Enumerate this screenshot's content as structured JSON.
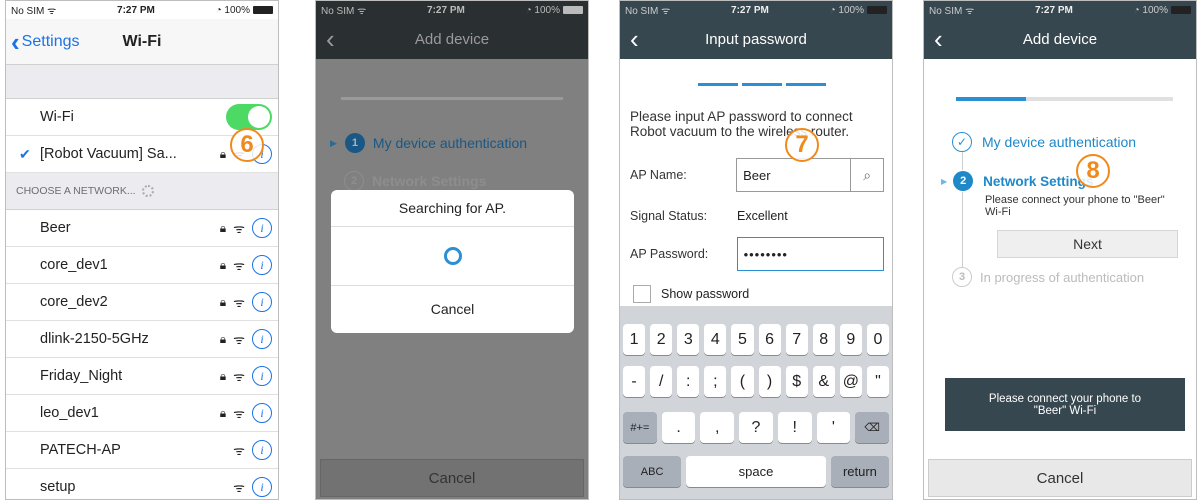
{
  "screen1": {
    "status": {
      "carrier": "No SIM",
      "time": "7:27 PM",
      "battery": "100%"
    },
    "back_label": "Settings",
    "title": "Wi-Fi",
    "wifi_label": "Wi-Fi",
    "connected_network": "[Robot Vacuum] Sa...",
    "section_header": "CHOOSE A NETWORK...",
    "networks": [
      "Beer",
      "core_dev1",
      "core_dev2",
      "dlink-2150-5GHz",
      "Friday_Night",
      "leo_dev1",
      "PATECH-AP",
      "setup"
    ],
    "step_badge": "6"
  },
  "screen2": {
    "status": {
      "carrier": "No SIM",
      "time": "7:27 PM",
      "battery": "100%"
    },
    "title": "Add device",
    "step1_label": "My device authentication",
    "step1_num": "1",
    "step2_label": "Network Settings",
    "step2_num": "2",
    "dialog_title": "Searching for AP.",
    "dialog_cancel": "Cancel",
    "bottom_cancel": "Cancel"
  },
  "screen3": {
    "status": {
      "carrier": "No SIM",
      "time": "7:27 PM",
      "battery": "100%"
    },
    "title": "Input password",
    "instruction": "Please input AP password to connect Robot vacuum to the wireless router.",
    "ap_name_label": "AP Name:",
    "ap_name_value": "Beer",
    "signal_label": "Signal Status:",
    "signal_value": "Excellent",
    "ap_password_label": "AP Password:",
    "ap_password_value": "••••••••",
    "show_password_label": "Show password",
    "step_badge": "7",
    "keyboard": {
      "row1": [
        "1",
        "2",
        "3",
        "4",
        "5",
        "6",
        "7",
        "8",
        "9",
        "0"
      ],
      "row2": [
        "-",
        "/",
        ":",
        ";",
        "(",
        ")",
        "$",
        "&",
        "@",
        "\""
      ],
      "row3": [
        "#+=",
        ".",
        ",",
        "?",
        "!",
        "'",
        "⌫"
      ],
      "row4": [
        "ABC",
        "space",
        "return"
      ]
    }
  },
  "screen4": {
    "status": {
      "carrier": "No SIM",
      "time": "7:27 PM",
      "battery": "100%"
    },
    "title": "Add device",
    "step1_label": "My device authentication",
    "step2_label": "Network Settings",
    "step2_num": "2",
    "step2_desc": "Please connect your phone to \"Beer\" Wi-Fi",
    "next_label": "Next",
    "step3_label": "In progress of authentication",
    "step3_num": "3",
    "toast_line1": "Please connect your phone to",
    "toast_line2": "\"Beer\" Wi-Fi",
    "bottom_cancel": "Cancel",
    "step_badge": "8"
  },
  "colors": {
    "accent": "#2b8fd6",
    "ios_blue": "#1b73e8",
    "toggle_green": "#4cd964",
    "header_dark": "#37474f",
    "badge_orange": "#f08a1c"
  }
}
